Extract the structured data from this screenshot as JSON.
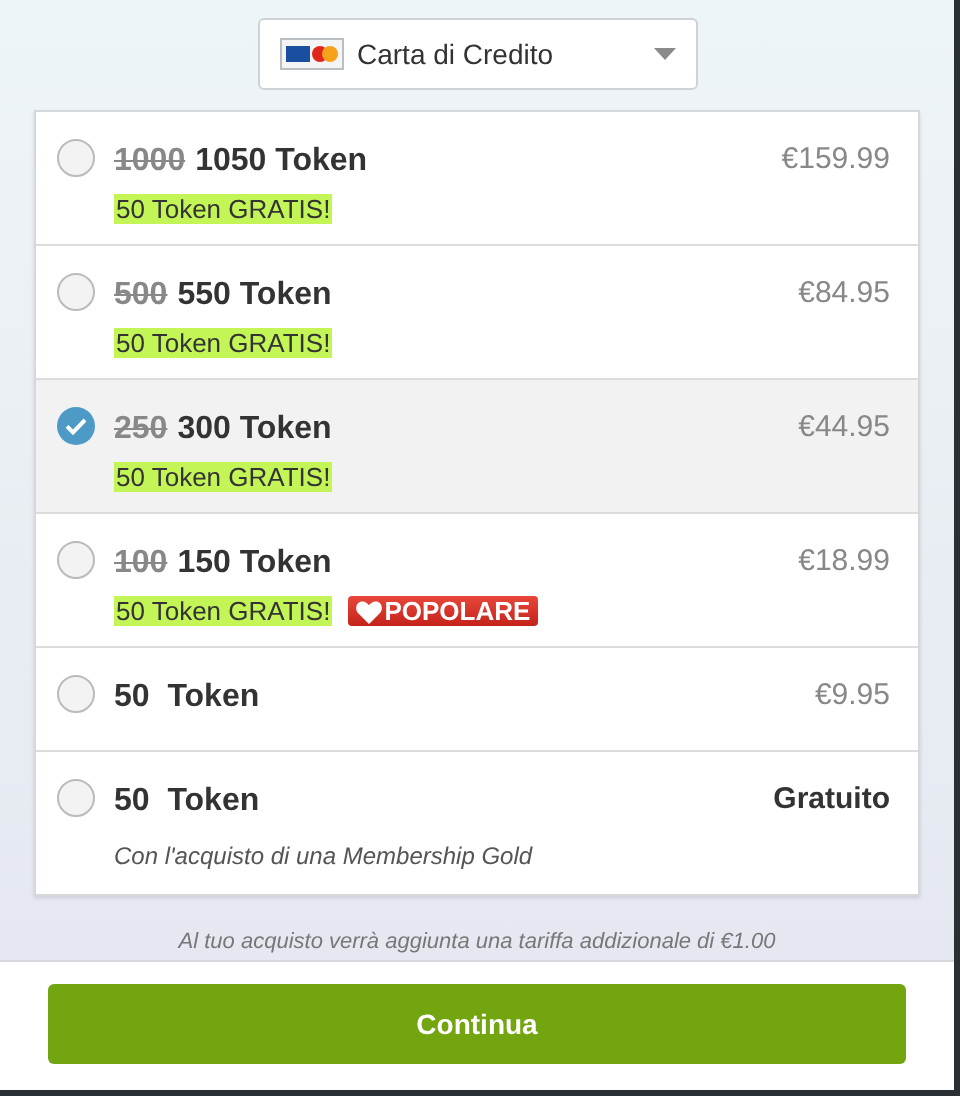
{
  "payment_method": {
    "value": "Carta di Credito"
  },
  "packages": [
    {
      "old_amount": "1000",
      "amount": "1050 Token",
      "price": "€159.99",
      "free": false,
      "bonus": "50 Token GRATIS!",
      "selected": false
    },
    {
      "old_amount": "500",
      "amount": "550 Token",
      "price": "€84.95",
      "free": false,
      "bonus": "50 Token GRATIS!",
      "selected": false
    },
    {
      "old_amount": "250",
      "amount": "300 Token",
      "price": "€44.95",
      "free": false,
      "bonus": "50 Token GRATIS!",
      "selected": true
    },
    {
      "old_amount": "100",
      "amount": "150 Token",
      "price": "€18.99",
      "free": false,
      "bonus": "50 Token GRATIS!",
      "badge": "POPOLARE",
      "selected": false
    },
    {
      "amount": "50  Token",
      "price": "€9.95",
      "free": false,
      "selected": false
    },
    {
      "amount": "50  Token",
      "price": "Gratuito",
      "free": true,
      "note": "Con l'acquisto di una Membership Gold",
      "selected": false
    }
  ],
  "fee_note": "Al tuo acquisto verrà aggiunta una tariffa addizionale di €1.00",
  "continue_button": "Continua"
}
